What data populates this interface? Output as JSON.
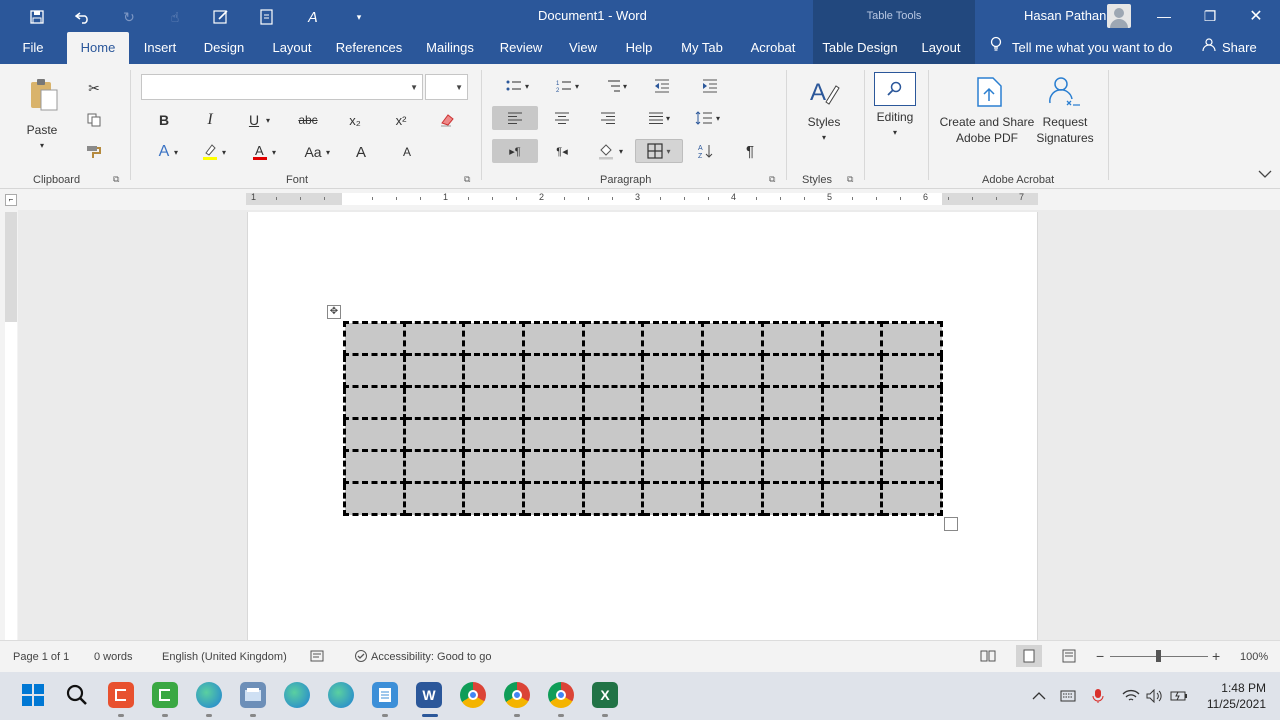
{
  "titlebar": {
    "doc_title": "Document1  -  Word",
    "table_tools": "Table Tools",
    "user_name": "Hasan Pathan"
  },
  "tabs": {
    "file": "File",
    "home": "Home",
    "insert": "Insert",
    "design": "Design",
    "layout": "Layout",
    "references": "References",
    "mailings": "Mailings",
    "review": "Review",
    "view": "View",
    "help": "Help",
    "mytab": "My Tab",
    "acrobat": "Acrobat",
    "table_design": "Table Design",
    "table_layout": "Layout",
    "tell_me": "Tell me what you want to do",
    "share": "Share"
  },
  "ribbon": {
    "clipboard": {
      "paste": "Paste",
      "label": "Clipboard"
    },
    "font": {
      "label": "Font",
      "name_value": "",
      "size_value": "",
      "bold": "B",
      "italic": "I",
      "underline": "U",
      "strike": "abc",
      "subscript": "x₂",
      "superscript": "x²",
      "change_case": "Aa",
      "grow": "A",
      "shrink": "A"
    },
    "paragraph": {
      "label": "Paragraph"
    },
    "styles": {
      "btn": "Styles",
      "label": "Styles"
    },
    "editing": {
      "btn": "Editing"
    },
    "acrobat": {
      "create_line1": "Create and Share",
      "create_line2": "Adobe PDF",
      "request_line1": "Request",
      "request_line2": "Signatures",
      "label": "Adobe Acrobat"
    }
  },
  "ruler": {
    "numbers": [
      "1",
      "1",
      "2",
      "3",
      "4",
      "5",
      "6",
      "7"
    ]
  },
  "table": {
    "rows": 6,
    "cols": 10
  },
  "statusbar": {
    "page": "Page 1 of 1",
    "words": "0 words",
    "language": "English (United Kingdom)",
    "accessibility": "Accessibility: Good to go",
    "zoom": "100%"
  },
  "taskbar": {
    "time": "1:48 PM",
    "date": "11/25/2021"
  },
  "colors": {
    "word_blue": "#2b579a",
    "context_blue": "#22487e",
    "cell_shading": "#c8c8c8"
  }
}
